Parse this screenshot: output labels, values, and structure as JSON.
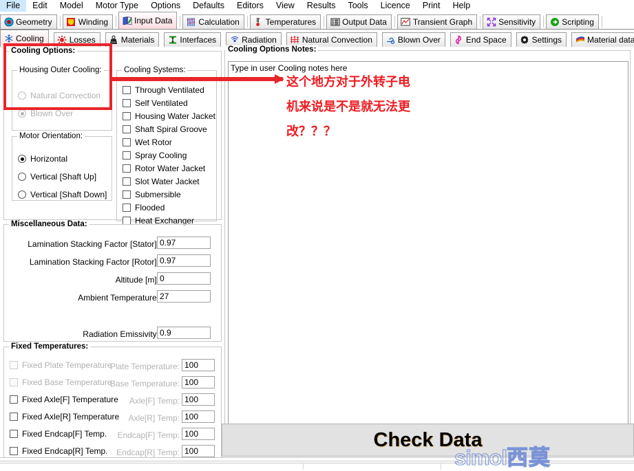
{
  "menubar": {
    "items": [
      {
        "label": "File"
      },
      {
        "label": "Edit"
      },
      {
        "label": "Model"
      },
      {
        "label": "Motor Type"
      },
      {
        "label": "Options"
      },
      {
        "label": "Defaults"
      },
      {
        "label": "Editors"
      },
      {
        "label": "View"
      },
      {
        "label": "Results"
      },
      {
        "label": "Tools"
      },
      {
        "label": "Licence"
      },
      {
        "label": "Print"
      },
      {
        "label": "Help"
      }
    ]
  },
  "tabs_primary": {
    "selected": "Input Data",
    "items": [
      {
        "label": "Geometry",
        "icon": "target-icon"
      },
      {
        "label": "Winding",
        "icon": "winding-icon"
      },
      {
        "label": "Input Data",
        "icon": "book-pencil-icon"
      },
      {
        "label": "Calculation",
        "icon": "sliders-icon"
      },
      {
        "label": "Temperatures",
        "icon": "thermometer-icon"
      },
      {
        "label": "Output Data",
        "icon": "grid-list-icon"
      },
      {
        "label": "Transient Graph",
        "icon": "line-chart-icon"
      },
      {
        "label": "Sensitivity",
        "icon": "expand-arrows-icon"
      },
      {
        "label": "Scripting",
        "icon": "green-arrow-icon"
      }
    ]
  },
  "tabs_secondary": {
    "selected": "Cooling",
    "items": [
      {
        "label": "Cooling",
        "icon": "snowflake-icon"
      },
      {
        "label": "Losses",
        "icon": "sun-burst-icon"
      },
      {
        "label": "Materials",
        "icon": "weight-icon"
      },
      {
        "label": "Interfaces",
        "icon": "i-beam-icon"
      },
      {
        "label": "Radiation",
        "icon": "radiation-waves-icon"
      },
      {
        "label": "Natural Convection",
        "icon": "arrows-up-icon"
      },
      {
        "label": "Blown Over",
        "icon": "fan-icon"
      },
      {
        "label": "End Space",
        "icon": "vortex-icon"
      },
      {
        "label": "Settings",
        "icon": "gear-icon"
      },
      {
        "label": "Material database",
        "icon": "layers-icon"
      }
    ]
  },
  "cooling_options": {
    "title": "Cooling Options:",
    "housing_outer_cooling": {
      "title": "Housing Outer Cooling:",
      "disabled": true,
      "selected": "Blown Over",
      "options": [
        {
          "label": "Natural Convection",
          "checked": false
        },
        {
          "label": "Blown Over",
          "checked": true
        }
      ]
    },
    "motor_orientation": {
      "title": "Motor Orientation:",
      "selected": "Horizontal",
      "options": [
        {
          "label": "Horizontal",
          "checked": true
        },
        {
          "label": "Vertical [Shaft Up]",
          "checked": false
        },
        {
          "label": "Vertical [Shaft Down]",
          "checked": false
        }
      ]
    },
    "cooling_systems": {
      "title": "Cooling Systems:",
      "options": [
        {
          "label": "Through Ventilated",
          "checked": false
        },
        {
          "label": "Self Ventilated",
          "checked": false
        },
        {
          "label": "Housing Water Jacket",
          "checked": false
        },
        {
          "label": "Shaft Spiral Groove",
          "checked": false
        },
        {
          "label": "Wet Rotor",
          "checked": false
        },
        {
          "label": "Spray Cooling",
          "checked": false
        },
        {
          "label": "Rotor Water Jacket",
          "checked": false
        },
        {
          "label": "Slot Water Jacket",
          "checked": false
        },
        {
          "label": "Submersible",
          "checked": false
        },
        {
          "label": "Flooded",
          "checked": false
        },
        {
          "label": "Heat Exchanger",
          "checked": false
        }
      ]
    }
  },
  "miscellaneous_data": {
    "title": "Miscellaneous Data:",
    "fields": [
      {
        "label": "Lamination Stacking Factor [Stator]:",
        "value": "0.97"
      },
      {
        "label": "Lamination Stacking Factor [Rotor]:",
        "value": "0.97"
      },
      {
        "label": "Altitude [m]:",
        "value": "0"
      },
      {
        "label": "Ambient Temperature:",
        "value": "27"
      },
      {
        "label": "Radiation Emissivity:",
        "value": "0.9"
      }
    ]
  },
  "fixed_temperatures": {
    "title": "Fixed Temperatures:",
    "rows": [
      {
        "checkbox_label": "Fixed Plate Temperature",
        "checked": false,
        "disabled": true,
        "field_label": "Plate Temperature:",
        "value": "100"
      },
      {
        "checkbox_label": "Fixed Base Temperature",
        "checked": false,
        "disabled": true,
        "field_label": "Base Temperature:",
        "value": "100"
      },
      {
        "checkbox_label": "Fixed Axle[F] Temperature",
        "checked": false,
        "disabled": false,
        "field_label": "Axle[F] Temp:",
        "value": "100"
      },
      {
        "checkbox_label": "Fixed Axle[R] Temperature",
        "checked": false,
        "disabled": false,
        "field_label": "Axle[R] Temp:",
        "value": "100"
      },
      {
        "checkbox_label": "Fixed Endcap[F] Temp.",
        "checked": false,
        "disabled": false,
        "field_label": "Endcap[F] Temp:",
        "value": "100"
      },
      {
        "checkbox_label": "Fixed Endcap[R] Temp.",
        "checked": false,
        "disabled": false,
        "field_label": "Endcap[R] Temp:",
        "value": "100"
      }
    ]
  },
  "notes_panel": {
    "title": "Cooling Options Notes:",
    "placeholder": "Type in user Cooling notes here",
    "value": "",
    "scroll_arrow": "«"
  },
  "check_data": {
    "label": "Check Data"
  },
  "watermark": {
    "latin": "simol",
    "cjk": "西莫"
  },
  "annotation": {
    "color": "#ee1c22",
    "lines": [
      "这个地方对于外转子电",
      "机来说是不是就无法更",
      "改？？？"
    ]
  }
}
